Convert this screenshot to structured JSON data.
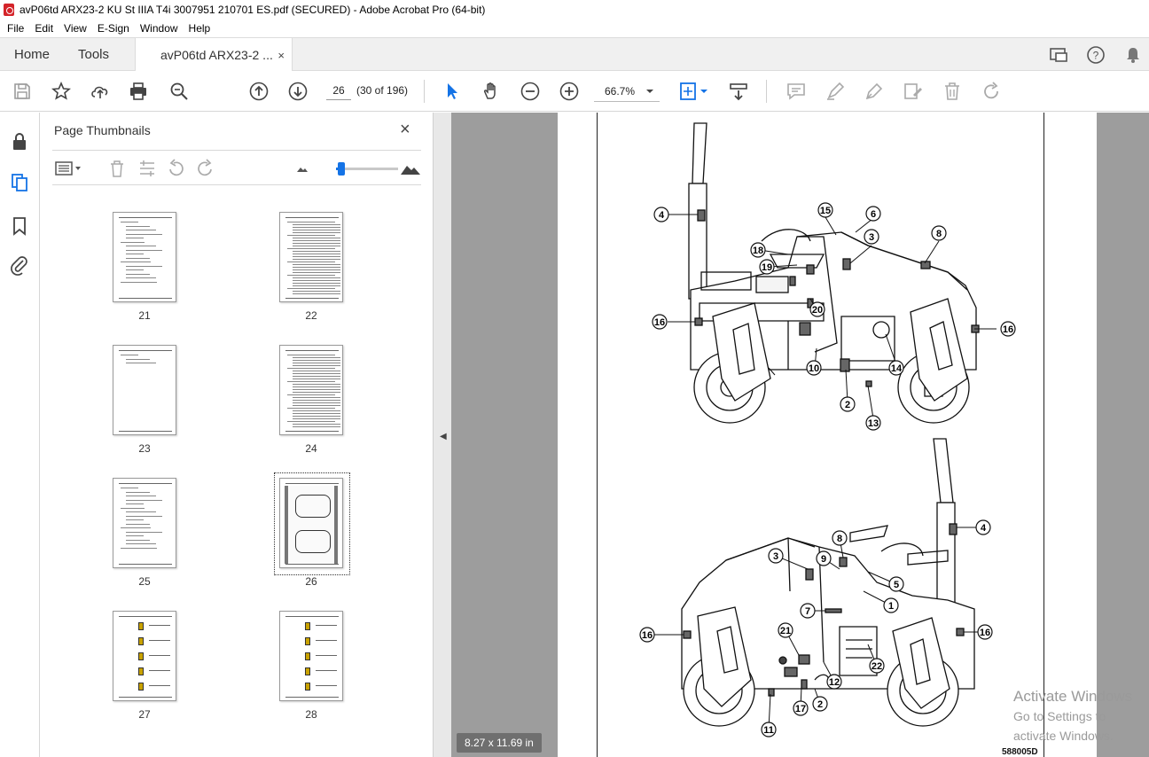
{
  "window": {
    "title": "avP06td ARX23-2 KU St IIIA T4i 3007951 210701 ES.pdf (SECURED) - Adobe Acrobat Pro (64-bit)"
  },
  "menu": [
    "File",
    "Edit",
    "View",
    "E-Sign",
    "Window",
    "Help"
  ],
  "tabs": {
    "home": "Home",
    "tools": "Tools",
    "document": "avP06td ARX23-2 ...",
    "close": "×"
  },
  "toolbar": {
    "page_number": "26",
    "page_count": "(30 of 196)",
    "zoom": "66.7%"
  },
  "thumbnails_panel": {
    "title": "Page Thumbnails",
    "close": "×",
    "pages": [
      {
        "label": "21",
        "style": "text"
      },
      {
        "label": "22",
        "style": "dense"
      },
      {
        "label": "23",
        "style": "sparse"
      },
      {
        "label": "24",
        "style": "dense"
      },
      {
        "label": "25",
        "style": "text"
      },
      {
        "label": "26",
        "style": "figure",
        "selected": true
      },
      {
        "label": "27",
        "style": "table"
      },
      {
        "label": "28",
        "style": "table"
      }
    ]
  },
  "document": {
    "page_size": "8.27 x 11.69 in",
    "figure_code": "588005D",
    "top_view_callouts": [
      "4",
      "15",
      "6",
      "3",
      "8",
      "18",
      "19",
      "20",
      "16",
      "16",
      "10",
      "14",
      "2",
      "13"
    ],
    "bottom_view_callouts": [
      "4",
      "8",
      "3",
      "9",
      "5",
      "1",
      "7",
      "21",
      "16",
      "16",
      "22",
      "12",
      "17",
      "2",
      "11"
    ]
  },
  "watermark": {
    "line1": "Activate Windows",
    "line2": "Go to Settings to activate Windows."
  },
  "colors": {
    "accent": "#1473e6",
    "doc_background": "#9d9d9d",
    "pdf_red": "#d4242a"
  }
}
